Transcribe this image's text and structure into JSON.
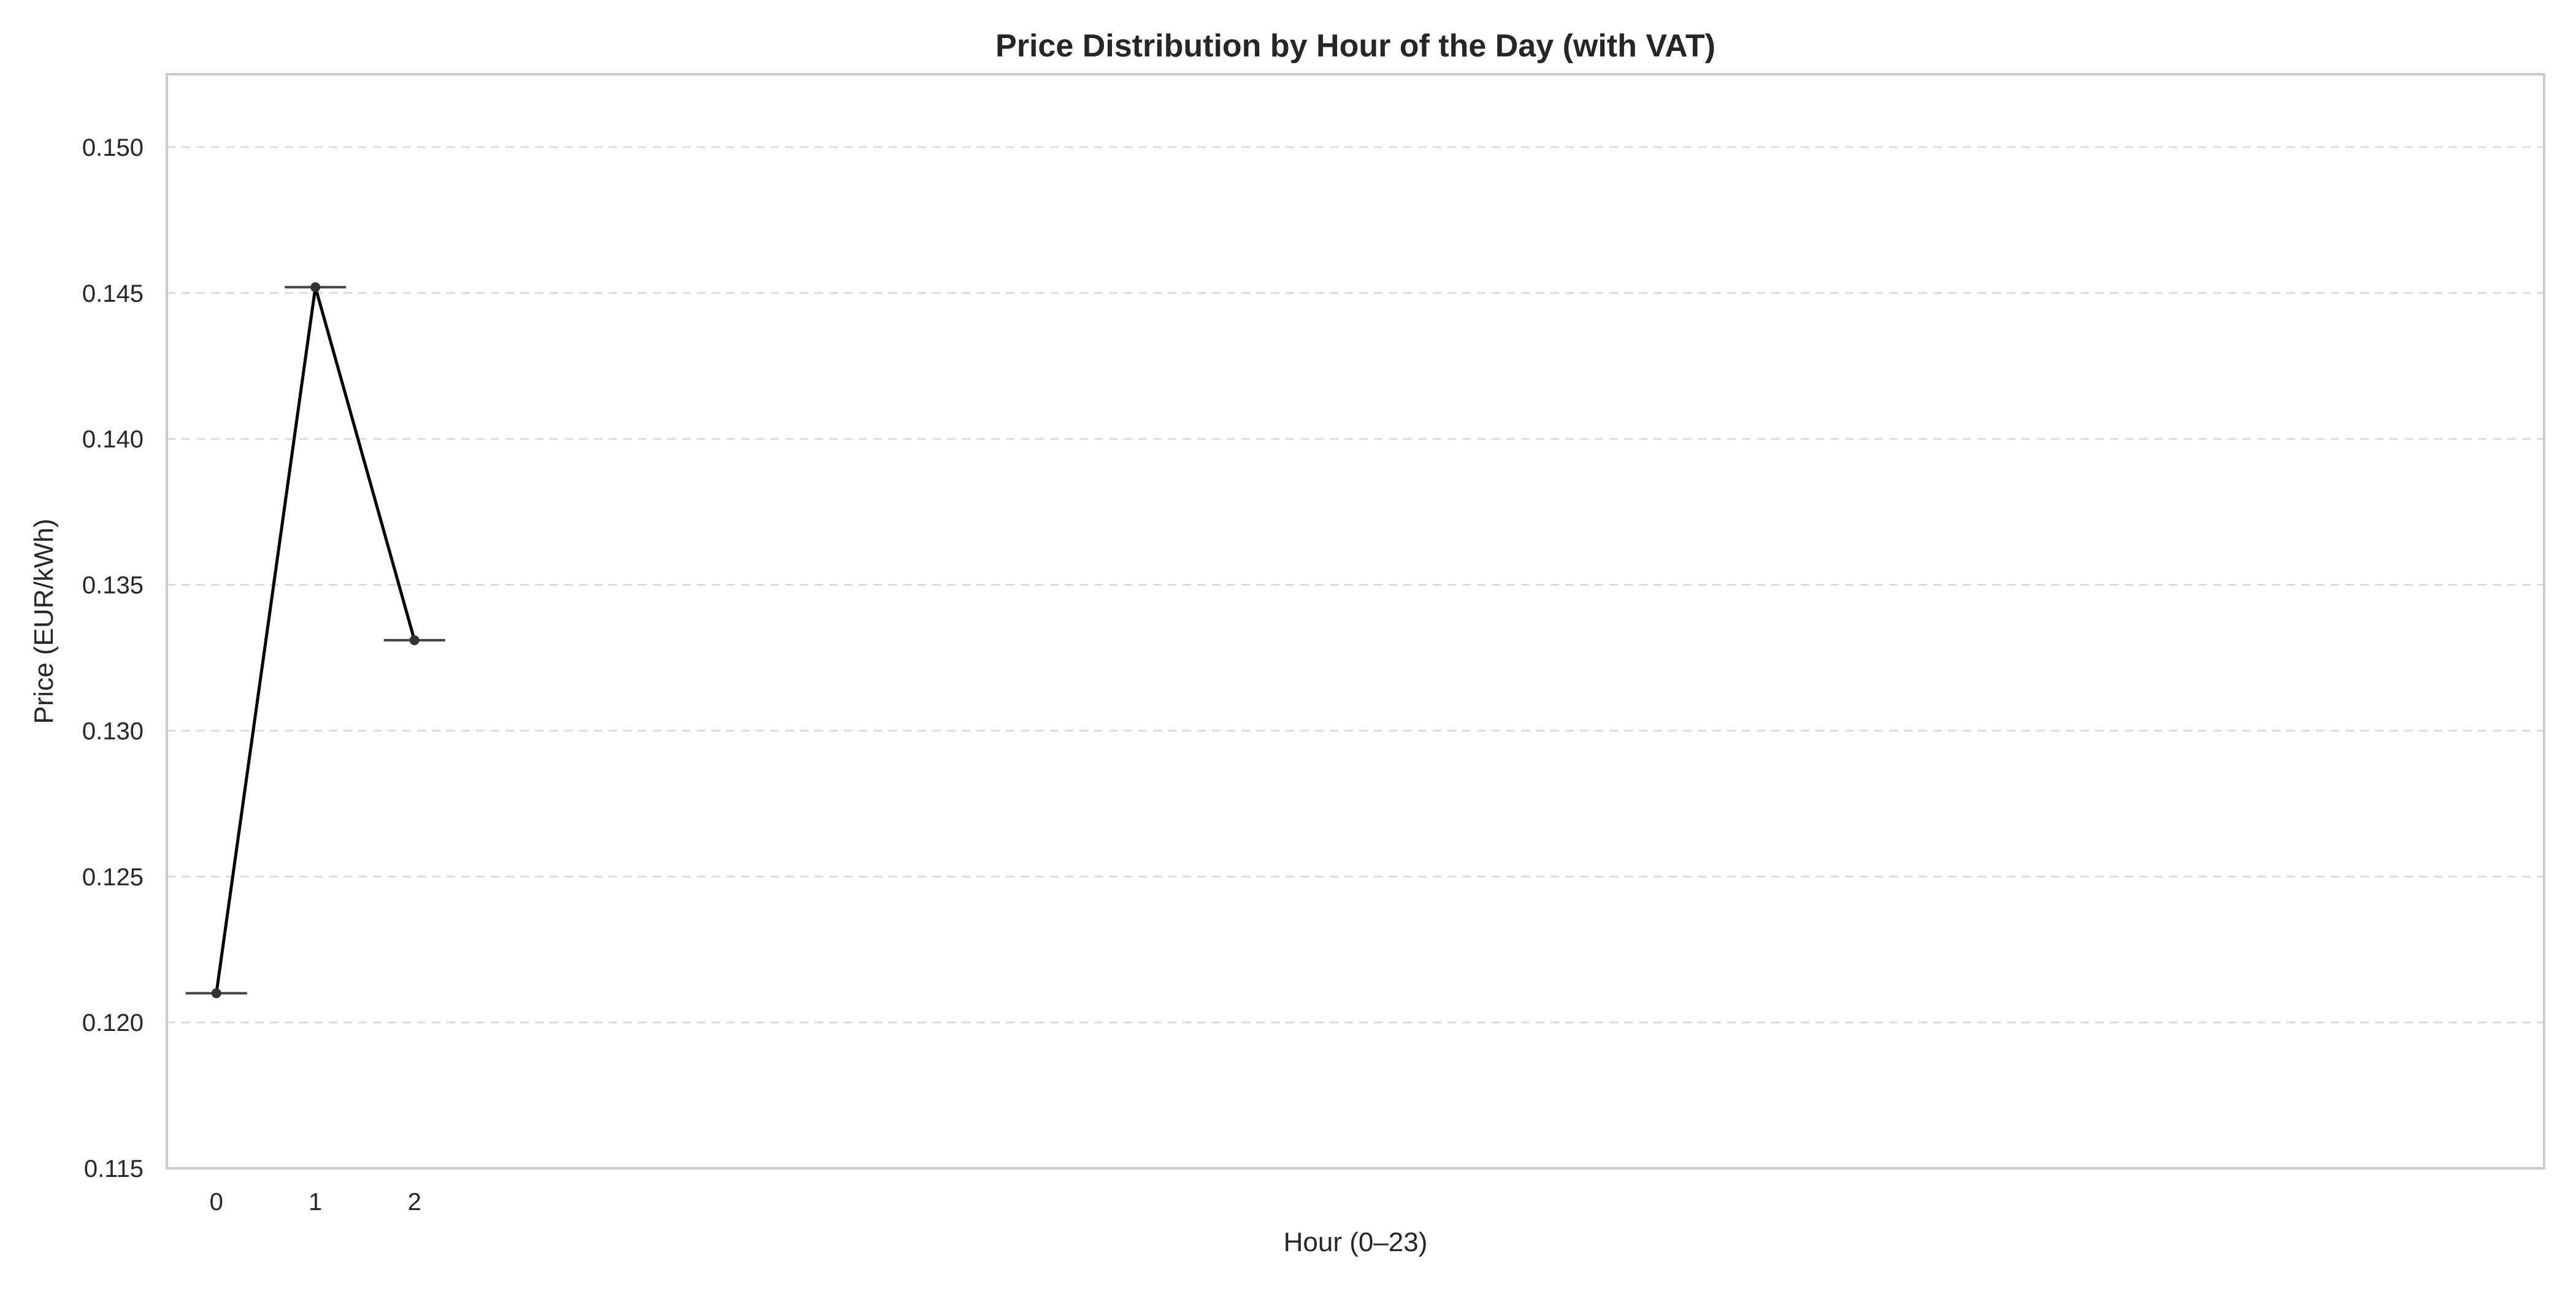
{
  "chart_data": {
    "type": "line",
    "title": "Price Distribution by Hour of the Day (with VAT)",
    "xlabel": "Hour (0–23)",
    "ylabel": "Price (EUR/kWh)",
    "x_categories": [
      "0",
      "1",
      "2"
    ],
    "x_range": [
      -0.5,
      23.5
    ],
    "ylim": [
      0.115,
      0.1525
    ],
    "yticks": [
      0.115,
      0.12,
      0.125,
      0.13,
      0.135,
      0.14,
      0.145,
      0.15
    ],
    "ytick_labels": [
      "0.115",
      "0.120",
      "0.125",
      "0.130",
      "0.135",
      "0.140",
      "0.145",
      "0.150"
    ],
    "grid": "y-dashed",
    "series": [
      {
        "type": "box",
        "x": [
          0,
          1,
          2
        ],
        "values": [
          0.121,
          0.1452,
          0.1331
        ],
        "color": "#444444"
      },
      {
        "type": "line",
        "x": [
          0,
          1,
          2
        ],
        "values": [
          0.121,
          0.1452,
          0.1331
        ],
        "color": "#000000",
        "marker_color": "#333333"
      }
    ]
  }
}
